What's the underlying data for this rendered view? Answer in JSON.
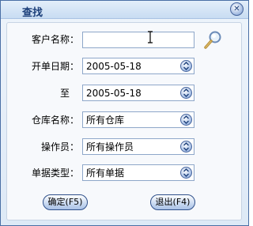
{
  "window": {
    "title": "查找",
    "close_glyph": "✕"
  },
  "form": {
    "customer_label": "客户名称：",
    "customer_value": "",
    "open_date_label": "开单日期：",
    "open_date_value": "2005-05-18",
    "to_label": "至",
    "to_date_value": "2005-05-18",
    "warehouse_label": "仓库名称：",
    "warehouse_value": "所有仓库",
    "operator_label": "操作员：",
    "operator_value": "所有操作员",
    "doc_type_label": "单据类型：",
    "doc_type_value": "所有单据"
  },
  "buttons": {
    "ok_label": "确定(F5)",
    "exit_label": "退出(F4)"
  },
  "icons": {
    "search": "magnifier-icon",
    "dropdown": "chevron-down-icon",
    "close": "close-icon"
  },
  "colors": {
    "title": "#1c3f7a",
    "border": "#4a6fa5",
    "accent": "#a9c1e6"
  }
}
